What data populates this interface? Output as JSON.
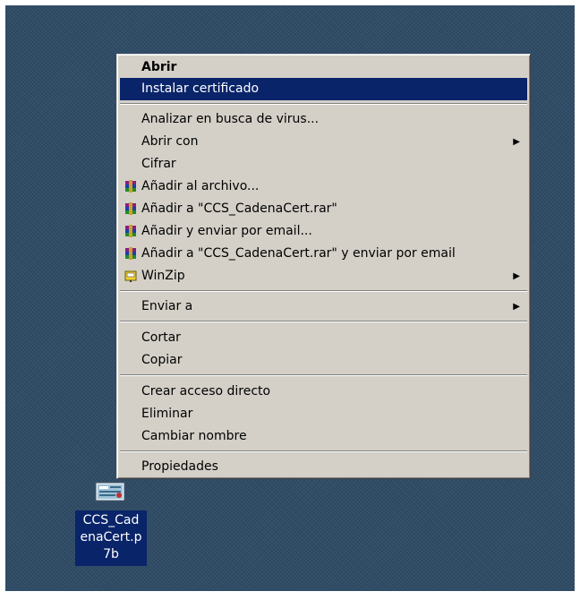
{
  "context_menu": {
    "items": [
      {
        "label": "Abrir",
        "bold": true
      },
      {
        "label": "Instalar certificado",
        "selected": true
      },
      {
        "label": "Analizar en busca de virus..."
      },
      {
        "label": "Abrir con",
        "submenu": true
      },
      {
        "label": "Cifrar"
      },
      {
        "label": "Añadir al archivo...",
        "icon": "winrar-icon"
      },
      {
        "label": "Añadir a \"CCS_CadenaCert.rar\"",
        "icon": "winrar-icon"
      },
      {
        "label": "Añadir y enviar por email...",
        "icon": "winrar-icon"
      },
      {
        "label": "Añadir a \"CCS_CadenaCert.rar\" y enviar por email",
        "icon": "winrar-icon"
      },
      {
        "label": "WinZip",
        "icon": "winzip-icon",
        "submenu": true
      },
      {
        "label": "Enviar a",
        "submenu": true
      },
      {
        "label": "Cortar"
      },
      {
        "label": "Copiar"
      },
      {
        "label": "Crear acceso directo"
      },
      {
        "label": "Eliminar"
      },
      {
        "label": "Cambiar nombre"
      },
      {
        "label": "Propiedades"
      }
    ],
    "submenu_arrow": "▶"
  },
  "desktop_file": {
    "name_lines": [
      "CCS_Cad",
      "enaCert.p",
      "7b"
    ],
    "icon": "certificate-file-icon"
  },
  "colors": {
    "desktop": "#2f4c66",
    "menu_bg": "#d4d0c8",
    "selection": "#0a246a"
  }
}
